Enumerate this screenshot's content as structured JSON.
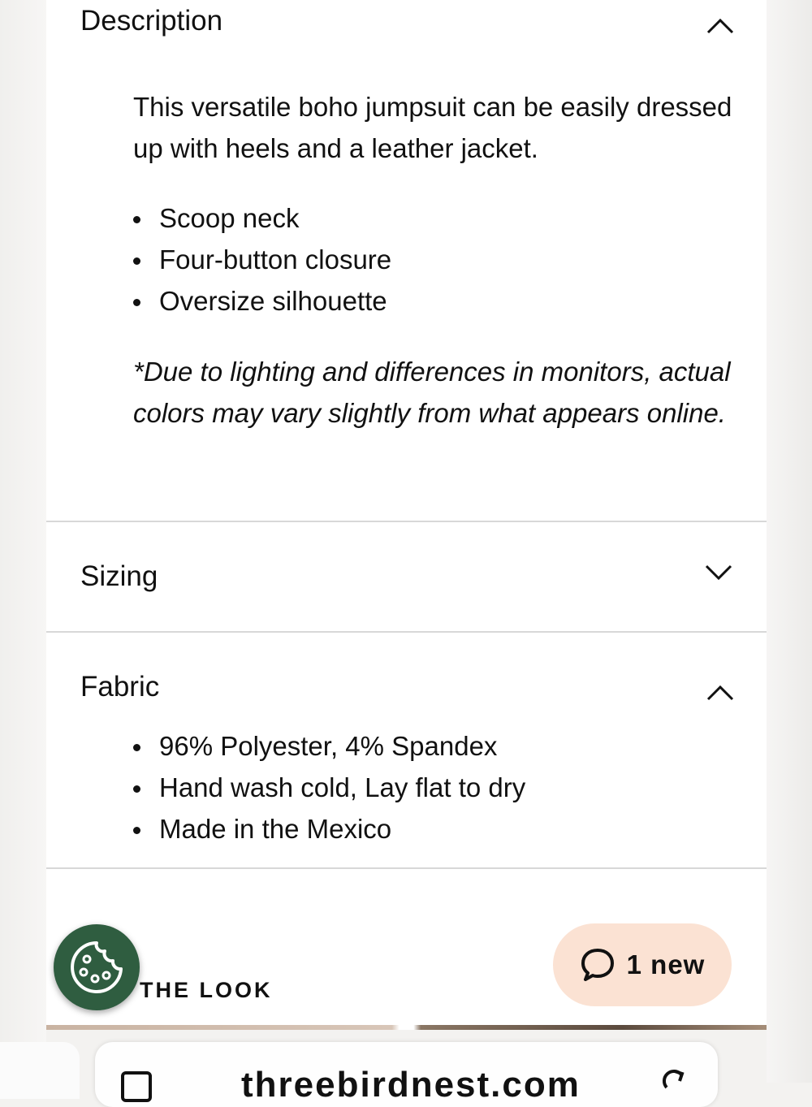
{
  "description": {
    "title": "Description",
    "paragraph": "This versatile boho jumpsuit can be easily dressed up with heels and a leather jacket.",
    "bullets": [
      "Scoop neck",
      "Four-button closure",
      "Oversize silhouette"
    ],
    "note": "*Due to lighting and differences in monitors, actual colors may vary slightly from what appears online.",
    "expanded": true
  },
  "sizing": {
    "title": "Sizing",
    "expanded": false
  },
  "fabric": {
    "title": "Fabric",
    "bullets": [
      "96% Polyester, 4% Spandex",
      "Hand wash cold, Lay flat to dry",
      "Made in the Mexico"
    ],
    "expanded": true
  },
  "look": {
    "label": "THE LOOK"
  },
  "chat": {
    "label": "1 new",
    "icon": "chat-bubble-icon"
  },
  "cookie": {
    "icon": "cookie-icon"
  },
  "browser": {
    "url": "threebirdnest.com"
  },
  "colors": {
    "cookie_bg": "#2f5d40",
    "chat_bg": "#fbe2d3"
  }
}
